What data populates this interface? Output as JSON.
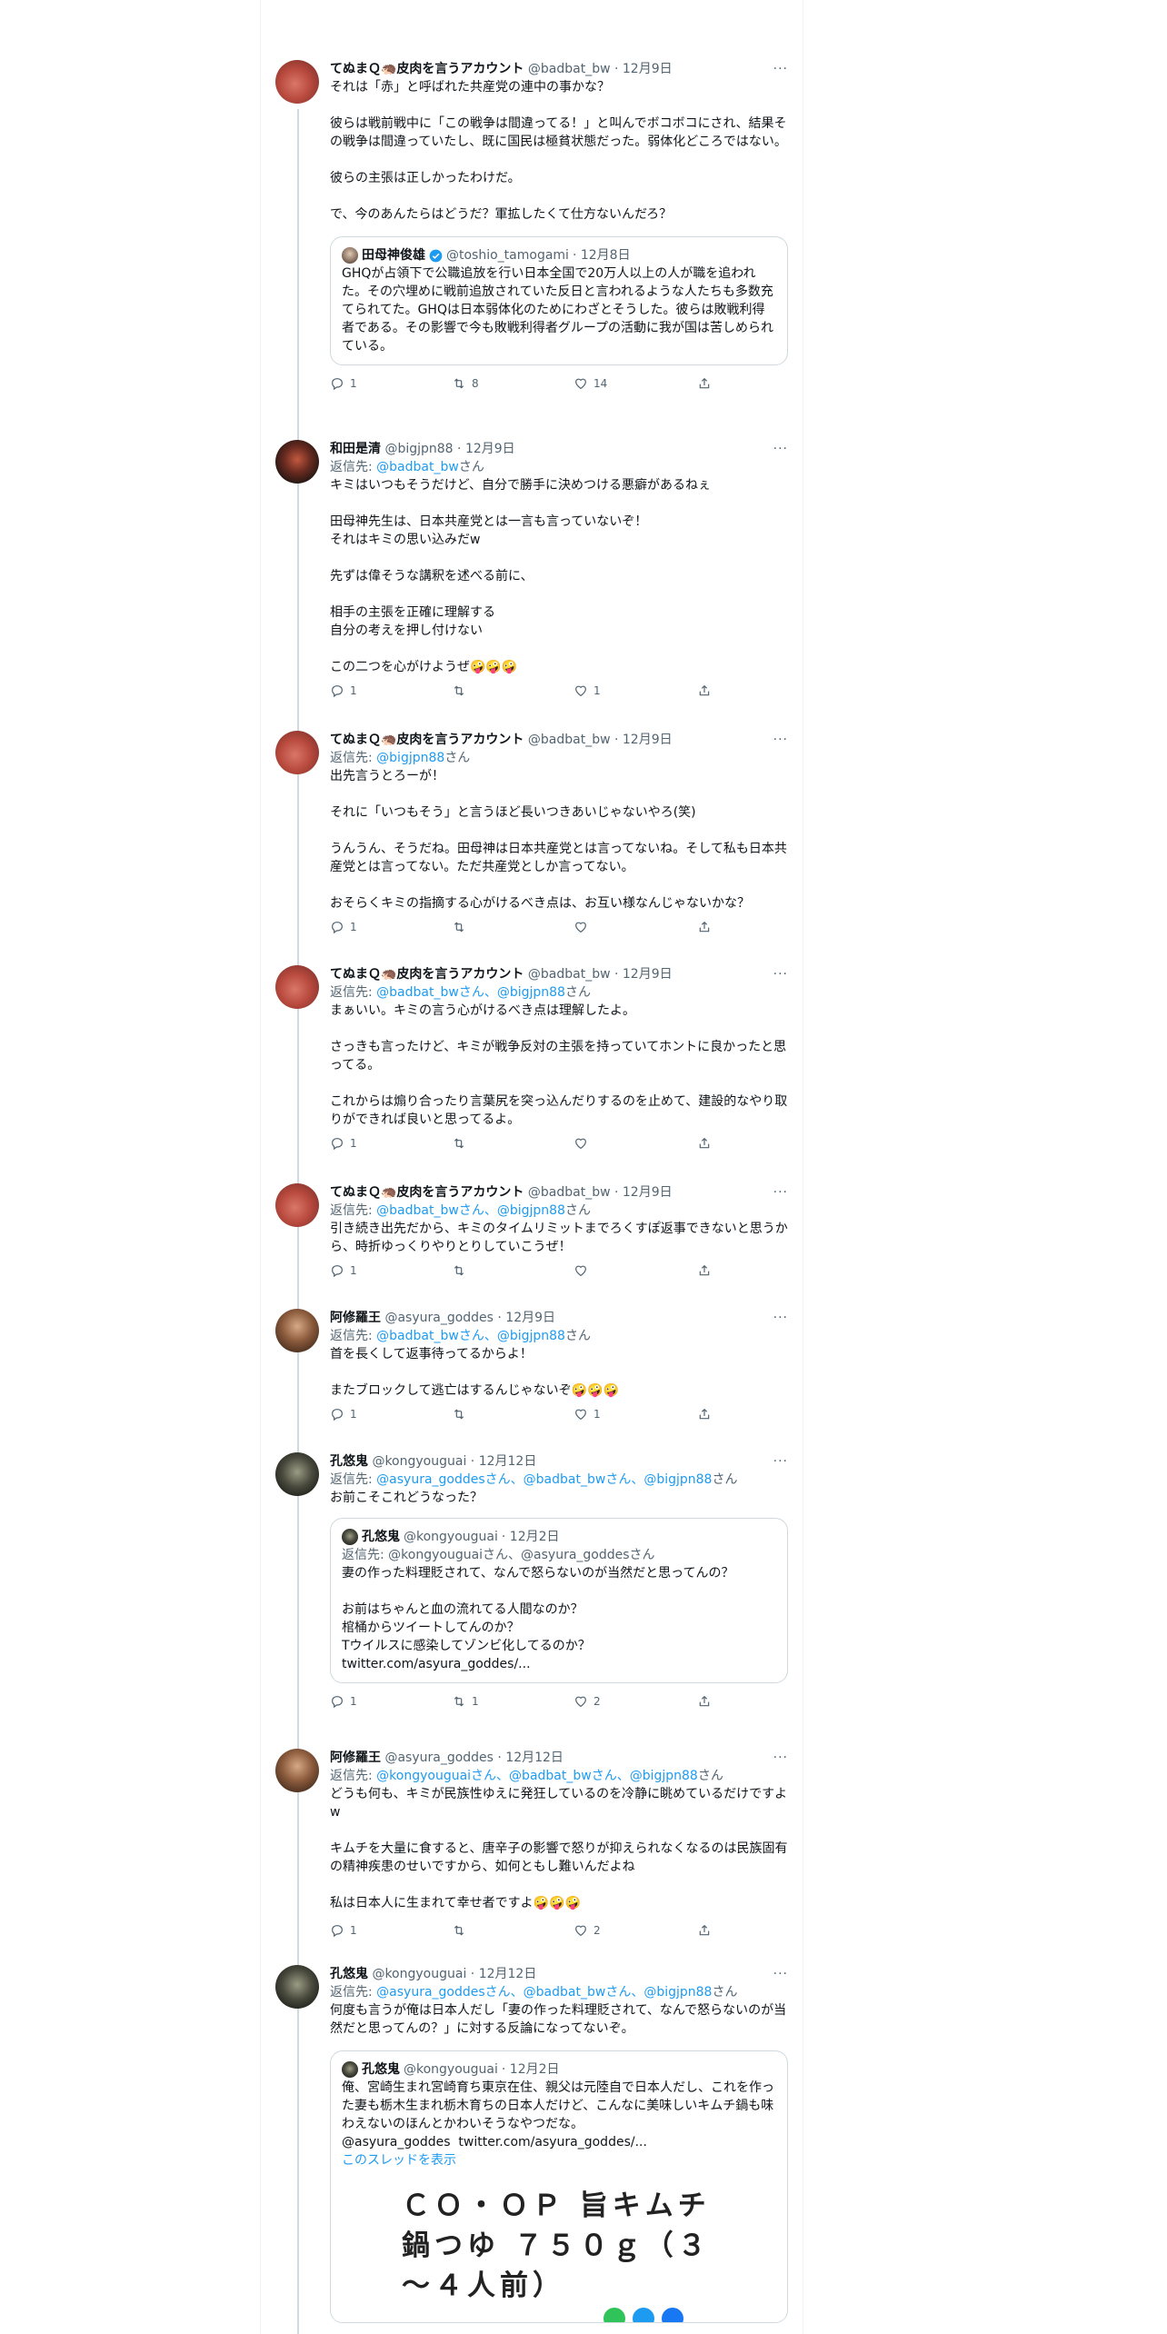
{
  "tweets": [
    {
      "name": "てぬまＱ🦔皮肉を言うアカウント",
      "handle": "@badbat_bw",
      "date": "· 12月9日",
      "more": "···",
      "text": "それは「赤」と呼ばれた共産党の連中の事かな？\n\n彼らは戦前戦中に「この戦争は間違ってる！」と叫んでボコボコにされ、結果その戦争は間違っていたし、既に国民は極貧状態だった。弱体化どころではない。\n\n彼らの主張は正しかったわけだ。\n\nで、今のあんたらはどうだ？軍拡したくて仕方ないんだろ？",
      "quote": {
        "name": "田母神俊雄",
        "handle": "@toshio_tamogami",
        "date": "· 12月8日",
        "text": "GHQが占領下で公職追放を行い日本全国で20万人以上の人が職を追われた。その穴埋めに戦前追放されていた反日と言われるような人たちも多数充てられてた。GHQは日本弱体化のためにわざとそうした。彼らは敗戦利得者である。その影響で今も敗戦利得者グループの活動に我が国は苦しめられている。"
      },
      "replies": "1",
      "retweets": "8",
      "likes": "14"
    },
    {
      "name": "和田是清",
      "handle": "@bigjpn88",
      "date": "· 12月9日",
      "more": "···",
      "reply_prefix": "返信先: ",
      "reply_mentions": "@badbat_bw",
      "reply_suffix": "さん",
      "text": "キミはいつもそうだけど、自分で勝手に決めつける悪癖があるねぇ\n\n田母神先生は、日本共産党とは一言も言っていないぞ！\nそれはキミの思い込みだw\n\n先ずは偉そうな講釈を述べる前に、\n\n相手の主張を正確に理解する\n自分の考えを押し付けない\n\nこの二つを心がけようぜ🤪🤪🤪",
      "replies": "1",
      "retweets": "",
      "likes": "1"
    },
    {
      "name": "てぬまＱ🦔皮肉を言うアカウント",
      "handle": "@badbat_bw",
      "date": "· 12月9日",
      "more": "···",
      "reply_prefix": "返信先: ",
      "reply_mentions": "@bigjpn88",
      "reply_suffix": "さん",
      "text": "出先言うとろーが！\n\nそれに「いつもそう」と言うほど長いつきあいじゃないやろ(笑)\n\nうんうん、そうだね。田母神は日本共産党とは言ってないね。そして私も日本共産党とは言ってない。ただ共産党としか言ってない。\n\nおそらくキミの指摘する心がけるべき点は、お互い様なんじゃないかな？",
      "replies": "1",
      "retweets": "",
      "likes": ""
    },
    {
      "name": "てぬまＱ🦔皮肉を言うアカウント",
      "handle": "@badbat_bw",
      "date": "· 12月9日",
      "more": "···",
      "reply_prefix": "返信先: ",
      "reply_mentions": "@badbat_bwさん、@bigjpn88",
      "reply_suffix": "さん",
      "text": "まぁいい。キミの言う心がけるべき点は理解したよ。\n\nさっきも言ったけど、キミが戦争反対の主張を持っていてホントに良かったと思ってる。\n\nこれからは煽り合ったり言葉尻を突っ込んだりするのを止めて、建設的なやり取りができれば良いと思ってるよ。",
      "replies": "1",
      "retweets": "",
      "likes": ""
    },
    {
      "name": "てぬまＱ🦔皮肉を言うアカウント",
      "handle": "@badbat_bw",
      "date": "· 12月9日",
      "more": "···",
      "reply_prefix": "返信先: ",
      "reply_mentions": "@badbat_bwさん、@bigjpn88",
      "reply_suffix": "さん",
      "text": "引き続き出先だから、キミのタイムリミットまでろくすぽ返事できないと思うから、時折ゆっくりやりとりしていこうぜ！",
      "replies": "1",
      "retweets": "",
      "likes": ""
    },
    {
      "name": "阿修羅王",
      "handle": "@asyura_goddes",
      "date": "· 12月9日",
      "more": "···",
      "reply_prefix": "返信先: ",
      "reply_mentions": "@badbat_bwさん、@bigjpn88",
      "reply_suffix": "さん",
      "text": "首を長くして返事待ってるからよ！\n\nまたブロックして逃亡はするんじゃないぞ🤪🤪🤪",
      "replies": "1",
      "retweets": "",
      "likes": "1"
    },
    {
      "name": "孔悠鬼",
      "handle": "@kongyouguai",
      "date": "· 12月12日",
      "more": "···",
      "reply_prefix": "返信先: ",
      "reply_mentions": "@asyura_goddesさん、@badbat_bwさん、@bigjpn88",
      "reply_suffix": "さん",
      "text": "お前こそこれどうなった？",
      "quote": {
        "name": "孔悠鬼",
        "handle": "@kongyouguai",
        "date": "· 12月2日",
        "reply": "返信先: @kongyouguaiさん、@asyura_goddesさん",
        "text": "妻の作った料理貶されて、なんで怒らないのが当然だと思ってんの？\n\nお前はちゃんと血の流れてる人間なのか？\n棺桶からツイートしてんのか？\nTウイルスに感染してゾンビ化してるのか？\ntwitter.com/asyura_goddes/..."
      },
      "replies": "1",
      "retweets": "1",
      "likes": "2"
    },
    {
      "name": "阿修羅王",
      "handle": "@asyura_goddes",
      "date": "· 12月12日",
      "more": "···",
      "reply_prefix": "返信先: ",
      "reply_mentions": "@kongyouguaiさん、@badbat_bwさん、@bigjpn88",
      "reply_suffix": "さん",
      "text": "どうも何も、キミが民族性ゆえに発狂しているのを冷静に眺めているだけですよw\n\nキムチを大量に食すると、唐辛子の影響で怒りが抑えられなくなるのは民族固有の精神疾患のせいですから、如何ともし難いんだよね\n\n私は日本人に生まれて幸せ者ですよ🤪🤪🤪",
      "replies": "1",
      "retweets": "",
      "likes": "2"
    },
    {
      "name": "孔悠鬼",
      "handle": "@kongyouguai",
      "date": "· 12月12日",
      "more": "···",
      "reply_prefix": "返信先: ",
      "reply_mentions": "@asyura_goddesさん、@badbat_bwさん、@bigjpn88",
      "reply_suffix": "さん",
      "text": "何度も言うが俺は日本人だし「妻の作った料理貶されて、なんで怒らないのが当然だと思ってんの？」に対する反論になってないぞ。",
      "quote": {
        "name": "孔悠鬼",
        "handle": "@kongyouguai",
        "date": "· 12月2日",
        "text": "俺、宮崎生まれ宮崎育ち東京在住、親父は元陸自で日本人だし、これを作った妻も栃木生まれ栃木育ちの日本人だけど、こんなに美味しいキムチ鍋も味わえないのほんとかわいそうなやつだな。\n@asyura_goddes  twitter.com/asyura_goddes/...",
        "show_thread": "このスレッドを表示",
        "ad_title": "ＣＯ・ＯＰ 旨キムチ鍋つゆ ７５０ｇ（３～４人前）"
      }
    }
  ]
}
